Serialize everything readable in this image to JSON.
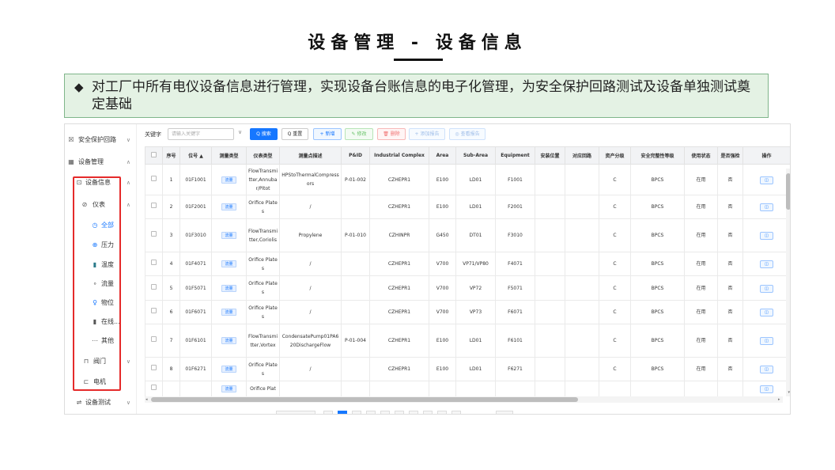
{
  "slide": {
    "title": "设备管理 - 设备信息",
    "bullet": "◆",
    "description": "对工厂中所有电仪设备信息进行管理，实现设备台账信息的电子化管理，为安全保护回路测试及设备单独测试奠定基础"
  },
  "sidebar": {
    "items": [
      {
        "icon": "☒",
        "icon_name": "safety-loop-icon",
        "label": "安全保护回路",
        "caret": "∨"
      },
      {
        "icon": "▦",
        "icon_name": "device-manage-icon",
        "label": "设备管理",
        "caret": "∧"
      },
      {
        "icon": "⊡",
        "icon_name": "device-info-icon",
        "label": "设备信息",
        "caret": "∧"
      },
      {
        "icon": "⊘",
        "icon_name": "instrument-icon",
        "label": "仪表",
        "caret": "∧"
      },
      {
        "icon": "◷",
        "icon_name": "all-icon",
        "label": "全部"
      },
      {
        "icon": "⊕",
        "icon_name": "pressure-icon",
        "label": "压力"
      },
      {
        "icon": "▮",
        "icon_name": "temperature-icon",
        "label": "温度"
      },
      {
        "icon": "∘",
        "icon_name": "flow-icon",
        "label": "流量"
      },
      {
        "icon": "♀",
        "icon_name": "level-icon",
        "label": "物位"
      },
      {
        "icon": "▮",
        "icon_name": "online-analyzer-icon",
        "label": "在线..."
      },
      {
        "icon": "⋯",
        "icon_name": "other-icon",
        "label": "其他"
      },
      {
        "icon": "⊓",
        "icon_name": "valve-icon",
        "label": "阀门",
        "caret": "∨"
      },
      {
        "icon": "⊏",
        "icon_name": "motor-icon",
        "label": "电机"
      },
      {
        "icon": "⇌",
        "icon_name": "device-test-icon",
        "label": "设备测试",
        "caret": "∨"
      }
    ]
  },
  "toolbar": {
    "keyword_label": "关键字",
    "search_placeholder": "请输入关键字",
    "dropdown_caret": "∨",
    "search_btn": "Q 搜索",
    "reset_btn": "Q 重置",
    "add_btn": "+ 新增",
    "edit_btn": "✎ 修改",
    "delete_btn": "🗑 删除",
    "add_report_btn": "+ 添加报告",
    "view_report_btn": "◎ 查看报告"
  },
  "table": {
    "columns": [
      "",
      "序号",
      "位号 ▲",
      "测量类型",
      "仪表类型",
      "测量点描述",
      "P&ID",
      "Industrial Complex",
      "Area",
      "Sub-Area",
      "Equipment",
      "安装位置",
      "对应回路",
      "资产分级",
      "安全完整性等级",
      "使用状态",
      "是否强检",
      "操作"
    ],
    "rows": [
      {
        "no": "1",
        "tag": "01F1001",
        "mtype": "流量",
        "itype": "FlowTransmitter,Annubar/Pitot",
        "desc": "HPStoThermalCompressors",
        "pid": "P-01-002",
        "complex": "CZHEPR1",
        "area": "E100",
        "subarea": "LD01",
        "equip": "F1001",
        "install": "",
        "loop": "",
        "grade": "C",
        "sil": "BPCS",
        "status": "在用",
        "forced": "否",
        "op": "◫"
      },
      {
        "no": "2",
        "tag": "01F2001",
        "mtype": "流量",
        "itype": "Orifice Plates",
        "desc": "/",
        "pid": "",
        "complex": "CZHEPR1",
        "area": "E100",
        "subarea": "LD01",
        "equip": "F2001",
        "install": "",
        "loop": "",
        "grade": "C",
        "sil": "BPCS",
        "status": "在用",
        "forced": "否",
        "op": "◫"
      },
      {
        "no": "3",
        "tag": "01F3010",
        "mtype": "流量",
        "itype": "FlowTransmitter,Coriolis",
        "desc": "Propylene",
        "pid": "P-01-010",
        "complex": "CZHINPR",
        "area": "G450",
        "subarea": "DT01",
        "equip": "F3010",
        "install": "",
        "loop": "",
        "grade": "C",
        "sil": "BPCS",
        "status": "在用",
        "forced": "否",
        "op": "◫"
      },
      {
        "no": "4",
        "tag": "01F4071",
        "mtype": "流量",
        "itype": "Orifice Plates",
        "desc": "/",
        "pid": "",
        "complex": "CZHEPR1",
        "area": "V700",
        "subarea": "VP71/VP80",
        "equip": "F4071",
        "install": "",
        "loop": "",
        "grade": "C",
        "sil": "BPCS",
        "status": "在用",
        "forced": "否",
        "op": "◫"
      },
      {
        "no": "5",
        "tag": "01F5071",
        "mtype": "流量",
        "itype": "Orifice Plates",
        "desc": "/",
        "pid": "",
        "complex": "CZHEPR1",
        "area": "V700",
        "subarea": "VP72",
        "equip": "F5071",
        "install": "",
        "loop": "",
        "grade": "C",
        "sil": "BPCS",
        "status": "在用",
        "forced": "否",
        "op": "◫"
      },
      {
        "no": "6",
        "tag": "01F6071",
        "mtype": "流量",
        "itype": "Orifice Plates",
        "desc": "/",
        "pid": "",
        "complex": "CZHEPR1",
        "area": "V700",
        "subarea": "VP73",
        "equip": "F6071",
        "install": "",
        "loop": "",
        "grade": "C",
        "sil": "BPCS",
        "status": "在用",
        "forced": "否",
        "op": "◫"
      },
      {
        "no": "7",
        "tag": "01F6101",
        "mtype": "流量",
        "itype": "FlowTransmitter,Vortex",
        "desc": "CondensatePump01PA620DischargeFlow",
        "pid": "P-01-004",
        "complex": "CZHEPR1",
        "area": "E100",
        "subarea": "LD01",
        "equip": "F6101",
        "install": "",
        "loop": "",
        "grade": "C",
        "sil": "BPCS",
        "status": "在用",
        "forced": "否",
        "op": "◫"
      },
      {
        "no": "8",
        "tag": "01F6271",
        "mtype": "流量",
        "itype": "Orifice Plates",
        "desc": "/",
        "pid": "",
        "complex": "CZHEPR1",
        "area": "E100",
        "subarea": "LD01",
        "equip": "F6271",
        "install": "",
        "loop": "",
        "grade": "C",
        "sil": "BPCS",
        "status": "在用",
        "forced": "否",
        "op": "◫"
      },
      {
        "no": "",
        "tag": "",
        "mtype": "流量",
        "itype": "Orifice Plat",
        "desc": "",
        "pid": "",
        "complex": "",
        "area": "",
        "subarea": "",
        "equip": "",
        "install": "",
        "loop": "",
        "grade": "",
        "sil": "",
        "status": "",
        "forced": "",
        "op": "◫"
      }
    ]
  },
  "scroll": {
    "left_arrow": "◂",
    "right_arrow": "▸",
    "up_arrow": "▴",
    "down_arrow": "▾"
  },
  "colors": {
    "primary": "#1677ff",
    "highlight_box": "#e52a2a",
    "description_bg": "#e4f2e4",
    "description_border": "#7fb58a"
  }
}
